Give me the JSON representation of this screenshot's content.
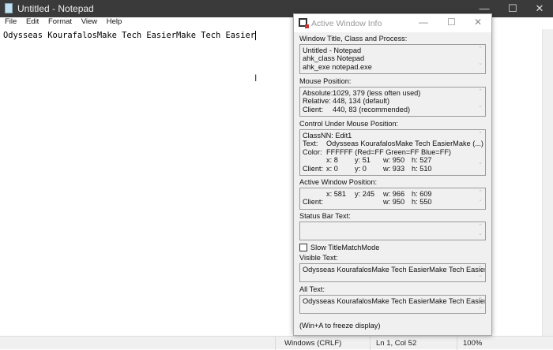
{
  "notepad": {
    "title": "Untitled - Notepad",
    "menu": [
      "File",
      "Edit",
      "Format",
      "View",
      "Help"
    ],
    "content": "Odysseas KourafalosMake Tech EasierMake Tech Easier",
    "status": {
      "line_ending": "Windows (CRLF)",
      "position": "Ln 1, Col 52",
      "zoom": "100%"
    }
  },
  "awi": {
    "title": "Active Window Info",
    "sections": {
      "window_label": "Window Title, Class and Process:",
      "window_lines": [
        "Untitled - Notepad",
        "ahk_class Notepad",
        "ahk_exe notepad.exe"
      ],
      "mouse_label": "Mouse Position:",
      "mouse_lines": [
        [
          "Absolute:",
          "1029, 379 (less often used)"
        ],
        [
          "Relative:",
          "448, 134 (default)"
        ],
        [
          "Client:",
          "440, 83 (recommended)"
        ]
      ],
      "control_label": "Control Under Mouse Position:",
      "control_classnn": "ClassNN:  Edit1",
      "control_text": [
        "Text:",
        "Odysseas KourafalosMake Tech EasierMake  (...)"
      ],
      "control_color": [
        "Color:",
        "FFFFFF (Red=FF Green=FF Blue=FF)"
      ],
      "control_pos": [
        "x: 8",
        "y: 51",
        "w: 950",
        "h: 527"
      ],
      "control_client": [
        "Client:",
        "x: 0",
        "y: 0",
        "w: 933",
        "h: 510"
      ],
      "active_label": "Active Window Position:",
      "active_pos": [
        "x: 581",
        "y: 245",
        "w: 966",
        "h: 609"
      ],
      "active_client": [
        "Client:",
        "w: 950",
        "h: 550"
      ],
      "statusbar_label": "Status Bar Text:",
      "statusbar_value": "",
      "slow_mode_label": "Slow TitleMatchMode",
      "slow_mode_checked": false,
      "visible_label": "Visible Text:",
      "visible_value": "Odysseas KourafalosMake Tech EasierMake Tech Easier",
      "all_label": "All Text:",
      "all_value": "Odysseas KourafalosMake Tech EasierMake Tech Easier",
      "footer": "(Win+A to freeze display)"
    }
  }
}
